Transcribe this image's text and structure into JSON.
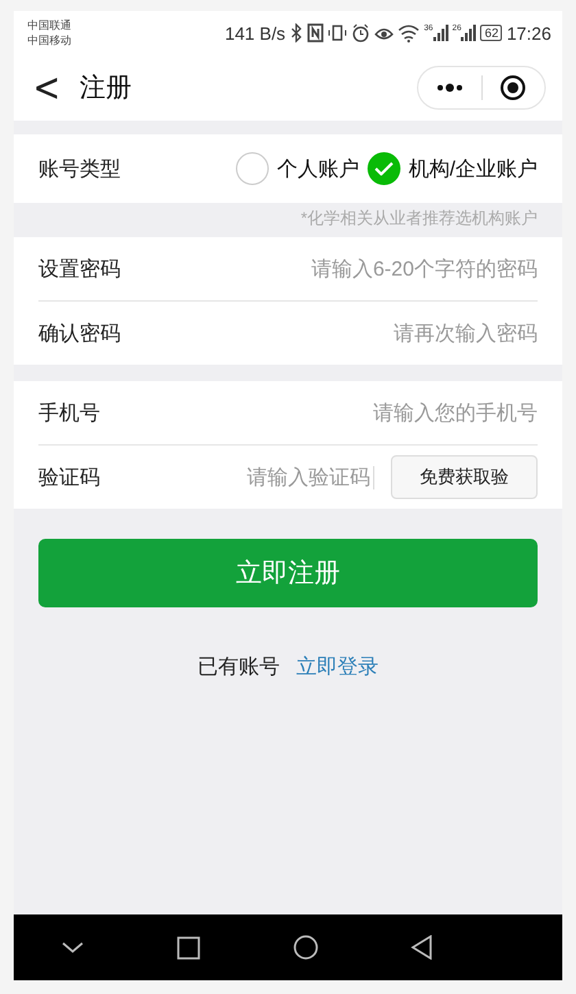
{
  "status_bar": {
    "carriers": [
      "中国联通",
      "中国移动"
    ],
    "speed": "141 B/s",
    "signal_labels": [
      "36",
      "26"
    ],
    "battery": "62",
    "time": "17:26"
  },
  "nav_bar": {
    "back": "<",
    "title": "注册"
  },
  "account_type": {
    "label": "账号类型",
    "options": [
      {
        "label": "个人账户",
        "selected": false
      },
      {
        "label": "机构/企业账户",
        "selected": true
      }
    ],
    "hint": "*化学相关从业者推荐选机构账户"
  },
  "groups": [
    [
      {
        "kind": "text",
        "label": "设置密码",
        "placeholder": "请输入6-20个字符的密码"
      },
      {
        "kind": "text",
        "label": "确认密码",
        "placeholder": "请再次输入密码"
      }
    ],
    [
      {
        "kind": "text",
        "label": "手机号",
        "placeholder": "请输入您的手机号"
      },
      {
        "kind": "code",
        "label": "验证码",
        "placeholder": "请输入验证码",
        "button": "免费获取验"
      }
    ]
  ],
  "submit": "立即注册",
  "login": {
    "text": "已有账号",
    "link": "立即登录"
  }
}
